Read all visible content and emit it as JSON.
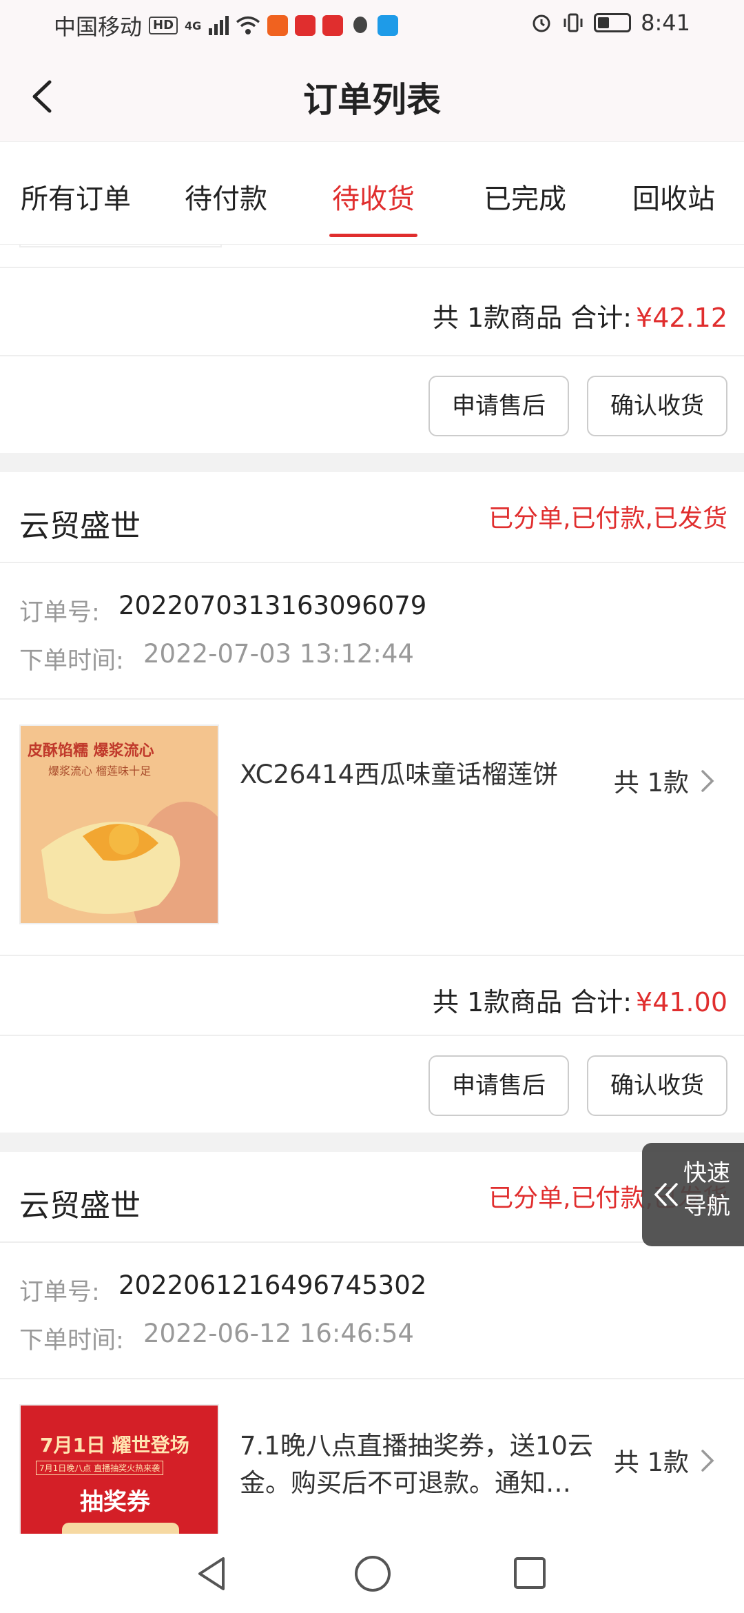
{
  "status_bar": {
    "carrier": "中国移动",
    "hd": "HD",
    "network": "4G",
    "time": "8:41"
  },
  "nav": {
    "title": "订单列表",
    "back_icon": "chevron-left-icon"
  },
  "tabs": [
    {
      "label": "所有订单",
      "active": false
    },
    {
      "label": "待付款",
      "active": false
    },
    {
      "label": "待收货",
      "active": true
    },
    {
      "label": "已完成",
      "active": false
    },
    {
      "label": "回收站",
      "active": false
    }
  ],
  "colors": {
    "accent": "#e02e2e",
    "muted": "#999999"
  },
  "orders": [
    {
      "summary_prefix": "共 1款商品  合计:",
      "total": "¥42.12",
      "after_sale": "申请售后",
      "confirm": "确认收货"
    },
    {
      "shop": "云贸盛世",
      "status": "已分单,已付款,已发货",
      "order_no_label": "订单号:",
      "order_no": "2022070313163096079",
      "time_label": "下单时间:",
      "time": "2022-07-03 13:12:44",
      "image_text": {
        "line1": "皮酥馅糯 爆浆流心",
        "line2": "爆浆流心 榴莲味十足"
      },
      "product": "XC26414西瓜味童话榴莲饼",
      "qty": "共 1款",
      "summary_prefix": "共 1款商品  合计:",
      "total": "¥41.00",
      "after_sale": "申请售后",
      "confirm": "确认收货"
    },
    {
      "shop": "云贸盛世",
      "status": "已分单,已付款,已发货",
      "order_no_label": "订单号:",
      "order_no": "2022061216496745302",
      "time_label": "下单时间:",
      "time": "2022-06-12 16:46:54",
      "image_text": {
        "line1": "7月1日 耀世登场",
        "line2": "7月1日晚八点 直播抽奖火热来袭",
        "line3": "抽奖券"
      },
      "product": "7.1晚八点直播抽奖券，送10云金。购买后不可退款。通知…",
      "qty": "共 1款"
    }
  ],
  "quick_nav": {
    "label": "快速导航"
  }
}
